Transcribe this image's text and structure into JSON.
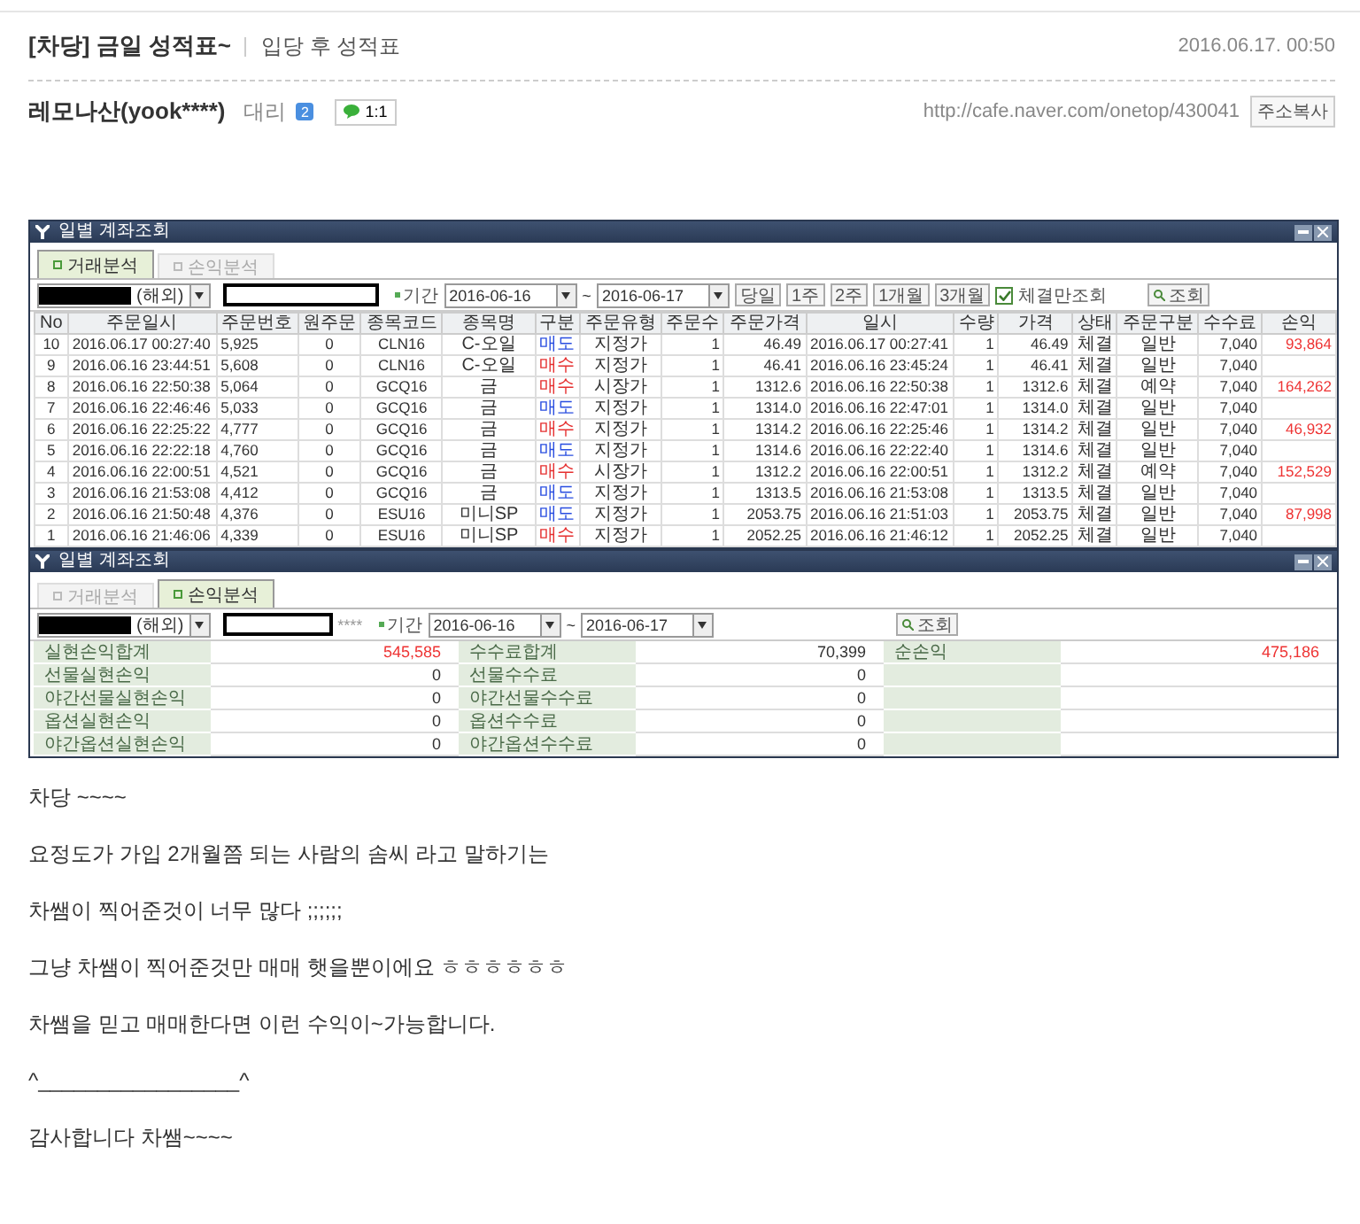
{
  "post": {
    "title": "[차당] 금일 성적표~",
    "category": "입당 후 성적표",
    "date": "2016.06.17. 00:50",
    "author": "레모나산(yook****)",
    "rank": "대리",
    "level_badge": "2",
    "chat": "1:1",
    "url": "http://cafe.naver.com/onetop/430041",
    "copy_button": "주소복사"
  },
  "window1": {
    "title": "일별 계좌조회",
    "tabs": [
      {
        "label": "거래분석",
        "selected": true
      },
      {
        "label": "손익분석",
        "selected": false
      }
    ],
    "account": "(해외)",
    "period_label": "기간",
    "date_from": "2016-06-16",
    "range_separator": "~",
    "date_to": "2016-06-17",
    "range_buttons": [
      "당일",
      "1주",
      "2주",
      "1개월",
      "3개월"
    ],
    "filled_only": {
      "label": "체결만조회",
      "checked": true
    },
    "search": "조회",
    "columns": [
      "No",
      "주문일시",
      "주문번호",
      "원주문",
      "종목코드",
      "종목명",
      "구분",
      "주문유형",
      "주문수",
      "주문가격",
      "일시",
      "수량",
      "가격",
      "상태",
      "주문구분",
      "수수료",
      "손익"
    ],
    "rows": [
      {
        "cells": [
          "10",
          "2016.06.17 00:27:40",
          "5,925",
          "0",
          "CLN16",
          "C-오일",
          "매도",
          "지정가",
          "1",
          "46.49",
          "2016.06.17 00:27:41",
          "1",
          "46.49",
          "체결",
          "일반",
          "7,040"
        ],
        "color": "#2a4ee0",
        "profit": "93,864"
      },
      {
        "cells": [
          "9",
          "2016.06.16 23:44:51",
          "5,608",
          "0",
          "CLN16",
          "C-오일",
          "매수",
          "지정가",
          "1",
          "46.41",
          "2016.06.16 23:45:24",
          "1",
          "46.41",
          "체결",
          "일반",
          "7,040"
        ],
        "color": "#e53030"
      },
      {
        "cells": [
          "8",
          "2016.06.16 22:50:38",
          "5,064",
          "0",
          "GCQ16",
          "금",
          "매수",
          "시장가",
          "1",
          "1312.6",
          "2016.06.16 22:50:38",
          "1",
          "1312.6",
          "체결",
          "예약",
          "7,040"
        ],
        "color": "#e53030",
        "profit": "164,262"
      },
      {
        "cells": [
          "7",
          "2016.06.16 22:46:46",
          "5,033",
          "0",
          "GCQ16",
          "금",
          "매도",
          "지정가",
          "1",
          "1314.0",
          "2016.06.16 22:47:01",
          "1",
          "1314.0",
          "체결",
          "일반",
          "7,040"
        ],
        "color": "#2a4ee0"
      },
      {
        "cells": [
          "6",
          "2016.06.16 22:25:22",
          "4,777",
          "0",
          "GCQ16",
          "금",
          "매수",
          "지정가",
          "1",
          "1314.2",
          "2016.06.16 22:25:46",
          "1",
          "1314.2",
          "체결",
          "일반",
          "7,040"
        ],
        "color": "#e53030",
        "profit": "46,932"
      },
      {
        "cells": [
          "5",
          "2016.06.16 22:22:18",
          "4,760",
          "0",
          "GCQ16",
          "금",
          "매도",
          "지정가",
          "1",
          "1314.6",
          "2016.06.16 22:22:40",
          "1",
          "1314.6",
          "체결",
          "일반",
          "7,040"
        ],
        "color": "#2a4ee0"
      },
      {
        "cells": [
          "4",
          "2016.06.16 22:00:51",
          "4,521",
          "0",
          "GCQ16",
          "금",
          "매수",
          "시장가",
          "1",
          "1312.2",
          "2016.06.16 22:00:51",
          "1",
          "1312.2",
          "체결",
          "예약",
          "7,040"
        ],
        "color": "#e53030",
        "profit": "152,529"
      },
      {
        "cells": [
          "3",
          "2016.06.16 21:53:08",
          "4,412",
          "0",
          "GCQ16",
          "금",
          "매도",
          "지정가",
          "1",
          "1313.5",
          "2016.06.16 21:53:08",
          "1",
          "1313.5",
          "체결",
          "일반",
          "7,040"
        ],
        "color": "#2a4ee0"
      },
      {
        "cells": [
          "2",
          "2016.06.16 21:50:48",
          "4,376",
          "0",
          "ESU16",
          "미니SP",
          "매도",
          "지정가",
          "1",
          "2053.75",
          "2016.06.16 21:51:03",
          "1",
          "2053.75",
          "체결",
          "일반",
          "7,040"
        ],
        "color": "#2a4ee0",
        "profit": "87,998"
      },
      {
        "cells": [
          "1",
          "2016.06.16 21:46:06",
          "4,339",
          "0",
          "ESU16",
          "미니SP",
          "매수",
          "지정가",
          "1",
          "2052.25",
          "2016.06.16 21:46:12",
          "1",
          "2052.25",
          "체결",
          "일반",
          "7,040"
        ],
        "color": "#e53030"
      }
    ]
  },
  "window2": {
    "title": "일별 계좌조회",
    "tabs": [
      {
        "label": "거래분석",
        "selected": false
      },
      {
        "label": "손익분석",
        "selected": true
      }
    ],
    "account": "(해외)",
    "masked": "****",
    "period_label": "기간",
    "date_from": "2016-06-16",
    "range_separator": "~",
    "date_to": "2016-06-17",
    "search": "조회",
    "summary": [
      {
        "label": "실현손익합계",
        "value": "545,585",
        "highlighted": true,
        "label2": "수수료합계",
        "value2": "70,399",
        "label3": "순손익",
        "value3": "475,186"
      },
      {
        "label": "선물실현손익",
        "value": "0",
        "highlighted": false,
        "label2": "선물수수료",
        "value2": "0"
      },
      {
        "label": "야간선물실현손익",
        "value": "0",
        "highlighted": false,
        "label2": "야간선물수수료",
        "value2": "0"
      },
      {
        "label": "옵션실현손익",
        "value": "0",
        "highlighted": false,
        "label2": "옵션수수료",
        "value2": "0"
      },
      {
        "label": "야간옵션실현손익",
        "value": "0",
        "highlighted": false,
        "label2": "야간옵션수수료",
        "value2": "0"
      }
    ]
  },
  "body": [
    "차당 ~~~~",
    "요정도가 가입 2개월쯤 되는 사람의 솜씨 라고 말하기는",
    "차쌤이 찍어준것이 너무 많다 ;;;;;;",
    "그냥 차쌤이 찍어준것만 매매 햇을뿐이에요 ㅎㅎㅎㅎㅎㅎ",
    "차쌤을 믿고 매매한다면 이런 수익이~가능합니다.",
    "^_________________^",
    "감사합니다 차쌤~~~~"
  ]
}
